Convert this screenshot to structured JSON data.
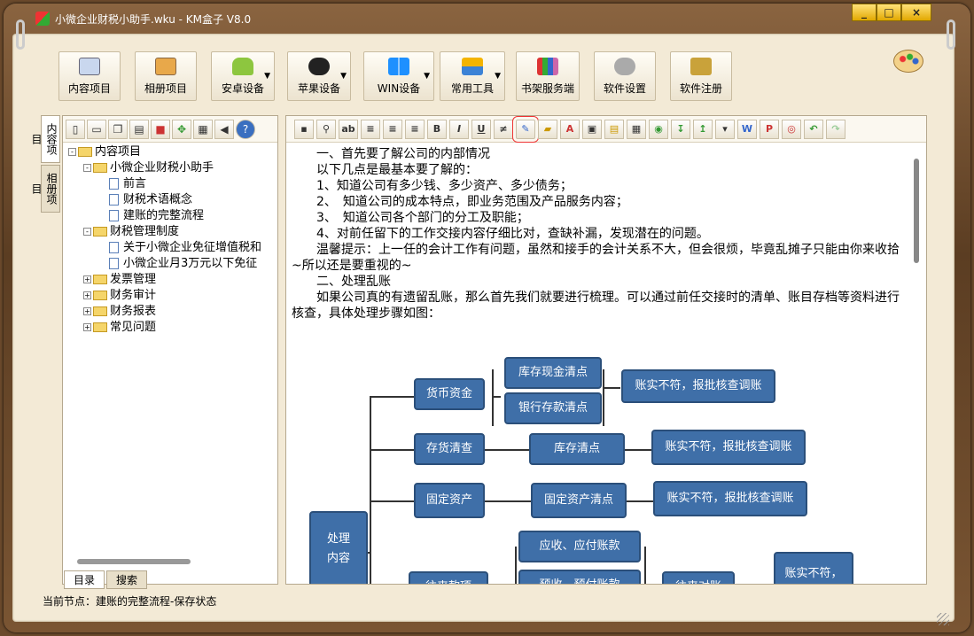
{
  "window": {
    "title": "小微企业财税小助手.wku - KM盒子 V8.0",
    "min": "_",
    "max": "□",
    "close": "×"
  },
  "toolbar": {
    "items": [
      {
        "label": "内容项目",
        "icon": "book-icon"
      },
      {
        "label": "相册项目",
        "icon": "album-icon"
      },
      {
        "label": "安卓设备",
        "icon": "android-icon"
      },
      {
        "label": "苹果设备",
        "icon": "apple-icon"
      },
      {
        "label": "WIN设备",
        "icon": "windows-icon"
      },
      {
        "label": "常用工具",
        "icon": "tools-icon"
      },
      {
        "label": "书架服务端",
        "icon": "bookshelf-icon"
      },
      {
        "label": "软件设置",
        "icon": "gear-icon"
      },
      {
        "label": "软件注册",
        "icon": "key-icon"
      }
    ]
  },
  "sidetabs": [
    "内容项目",
    "相册项目"
  ],
  "tree": {
    "nodes": [
      {
        "label": "内容项目",
        "level": 0,
        "type": "folder",
        "expand": "-"
      },
      {
        "label": "小微企业财税小助手",
        "level": 1,
        "type": "folder",
        "expand": "-"
      },
      {
        "label": "前言",
        "level": 2,
        "type": "doc"
      },
      {
        "label": "财税术语概念",
        "level": 2,
        "type": "doc"
      },
      {
        "label": "建账的完整流程",
        "level": 2,
        "type": "doc"
      },
      {
        "label": "财税管理制度",
        "level": 1,
        "type": "folder",
        "expand": "-"
      },
      {
        "label": "关于小微企业免征增值税和",
        "level": 2,
        "type": "doc"
      },
      {
        "label": "小微企业月3万元以下免征",
        "level": 2,
        "type": "doc"
      },
      {
        "label": "发票管理",
        "level": 1,
        "type": "folder",
        "expand": "+"
      },
      {
        "label": "财务审计",
        "level": 1,
        "type": "folder",
        "expand": "+"
      },
      {
        "label": "财务报表",
        "level": 1,
        "type": "folder",
        "expand": "+"
      },
      {
        "label": "常见问题",
        "level": 1,
        "type": "folder",
        "expand": "+"
      }
    ]
  },
  "bottomtabs": {
    "catalog": "目录",
    "search": "搜索"
  },
  "content": {
    "lines": [
      "　　一、首先要了解公司的内部情况",
      "　　以下几点是最基本要了解的：",
      "　　1、知道公司有多少钱、多少资产、多少债务；",
      "　　2、　知道公司的成本特点，即业务范围及产品服务内容；",
      "　　3、　知道公司各个部门的分工及职能；",
      "　　4、对前任留下的工作交接内容仔细比对，查缺补漏，发现潜在的问题。",
      "　　温馨提示：上一任的会计工作有问题，虽然和接手的会计关系不大，但会很烦，毕竟乱摊子只能由你来收拾~所以还是要重视的~",
      "　　二、处理乱账",
      "　　如果公司真的有遗留乱账，那么首先我们就要进行梳理。可以通过前任交接时的清单、账目存档等资料进行核查，具体处理步骤如图："
    ]
  },
  "diagram": {
    "root": "处理\n内容",
    "currency": "货币资金",
    "cash_check": "库存现金清点",
    "bank_check": "银行存款清点",
    "mismatch1": "账实不符，报批核查调账",
    "inventory": "存货清查",
    "inventory_check": "库存清点",
    "mismatch2": "账实不符，报批核查调账",
    "fixed": "固定资产",
    "fixed_check": "固定资产清点",
    "mismatch3": "账实不符，报批核查调账",
    "receivable": "应收、应付账款",
    "prepaid": "预收、预付账款",
    "contacts": "往来款项",
    "contact_check": "往来对账",
    "mismatch4": "账实不符，"
  },
  "status": {
    "text": "当前节点：建账的完整流程-保存状态"
  }
}
